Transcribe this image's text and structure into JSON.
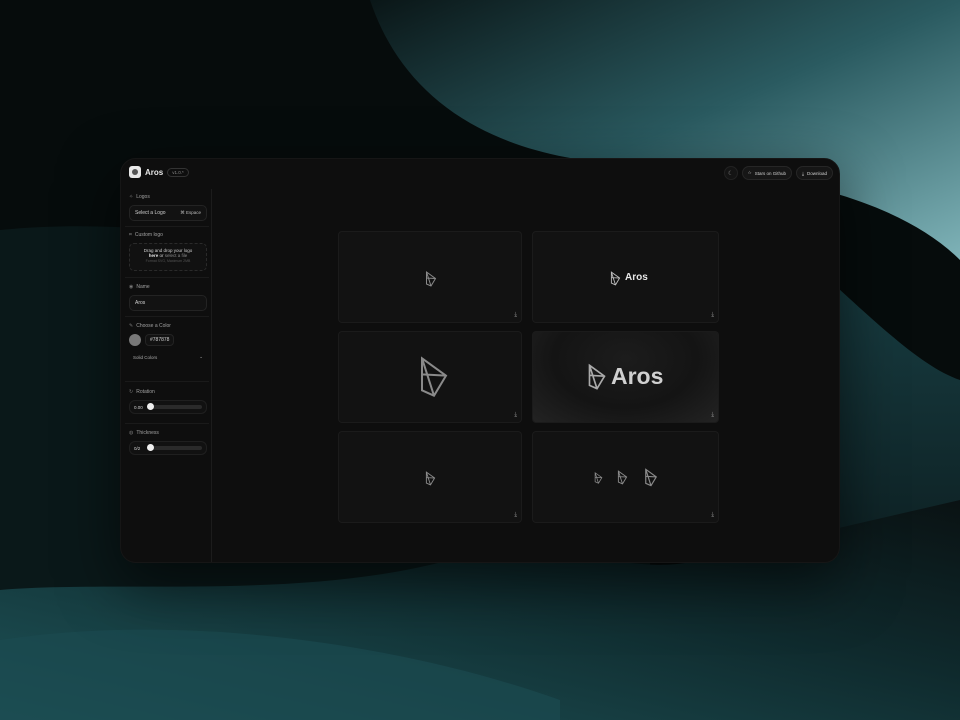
{
  "app": {
    "name": "Aros",
    "version": "v1.0.*"
  },
  "topbar": {
    "theme_icon": "moon-icon",
    "github_label": "Stars on Github",
    "github_icon": "star-icon",
    "download_label": "Download",
    "download_icon": "download-icon"
  },
  "sidebar": {
    "logos": {
      "label": "Logos",
      "select_label": "Select a Logo",
      "shortcut": "⌘ Espace"
    },
    "custom_logo": {
      "label": "Custom logo",
      "drop_line1": "Drag and drop your logo",
      "drop_here": "here",
      "drop_or": "or",
      "drop_link": "select a file",
      "drop_hint": "Format SVG, Maximum 2MB"
    },
    "name": {
      "label": "Name",
      "value": "Aros"
    },
    "color": {
      "label": "Choose a Color",
      "swatch": "#787878",
      "hex": "#787878",
      "mode": "Solid Colors"
    },
    "rotation": {
      "label": "Rotation",
      "value": "0.00",
      "level": 0.0
    },
    "thickness": {
      "label": "Thickness",
      "value": "0/2",
      "level": 0.0
    }
  },
  "previews": {
    "wordmark": "Aros",
    "download_icon": "download-icon"
  },
  "colors": {
    "accent": "#1f5d63",
    "panel": "#0e0e0e"
  }
}
